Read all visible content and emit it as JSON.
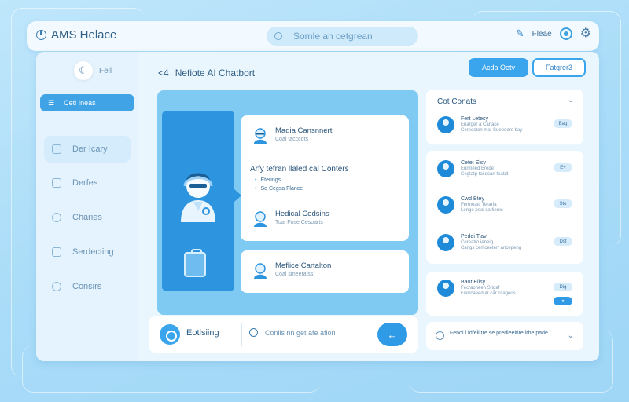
{
  "colors": {
    "accent": "#3aa5ec",
    "deep": "#2d94df",
    "panel": "#7fcaf3",
    "text": "#2a5b82"
  },
  "topbar": {
    "brand": "AMS Helace",
    "search_placeholder": "Somle an cetgrean",
    "action_label": "Fleae"
  },
  "sidebar": {
    "user_label": "Fell",
    "active_item": "Ceti Ineas",
    "items": [
      "Der Icary",
      "Derfes",
      "Charies",
      "Serdecting",
      "Consirs"
    ]
  },
  "chat": {
    "title_prefix": "<4",
    "title": "Nefiote AI Chatbort",
    "btn_primary": "Acda Oetv",
    "btn_secondary": "Fatgrer3",
    "msg1": {
      "title": "Madia Cansnnert",
      "sub": "Coal tacccots",
      "question": "Arfy tefran llaled cal Conters",
      "bullets": [
        "Eterings",
        "So Cegsa Flance"
      ],
      "row2_title": "Hedical Cedsins",
      "row2_sub": "Tual Fose Cesoarts"
    },
    "msg2": {
      "title": "Meflice Cartalton",
      "sub": "Coal smeeralss"
    },
    "input_label": "Eotlsiing",
    "input_placeholder": "Conlis nn get afe afion",
    "send_glyph": "←"
  },
  "contacts": {
    "title": "Cot Conats",
    "chevron": "⌄",
    "list": [
      {
        "title": "Fert Letesy",
        "sub1": "Enarger a Canace",
        "sub2": "Cereeston mat Sueeeere bay",
        "pill": "Bag"
      },
      {
        "title": "Cetet Elsy",
        "sub1": "Eurmeed Erede",
        "sub2": "Cegtatp tai dcan teatdt",
        "pill": "E+"
      },
      {
        "title": "Cwd Btey",
        "sub1": "Fermeatc Terarfa",
        "sub2": "Lenge peal carlieres",
        "pill": "Sto"
      },
      {
        "title": "Peddi Tiav",
        "sub1": "Cereatro ieneig",
        "sub2": "Cangs cerl ceeterr ancepeng",
        "pill": "Dst"
      },
      {
        "title": "Baot Elisy",
        "sub1": "Fecraoneen Srigaf",
        "sub2": "Fierrcaeed ar car ccageus",
        "pill": "Dig",
        "pill2": "●"
      }
    ],
    "footer": "Fenol i tdfeil tre se predieeitire lrhe pade"
  }
}
